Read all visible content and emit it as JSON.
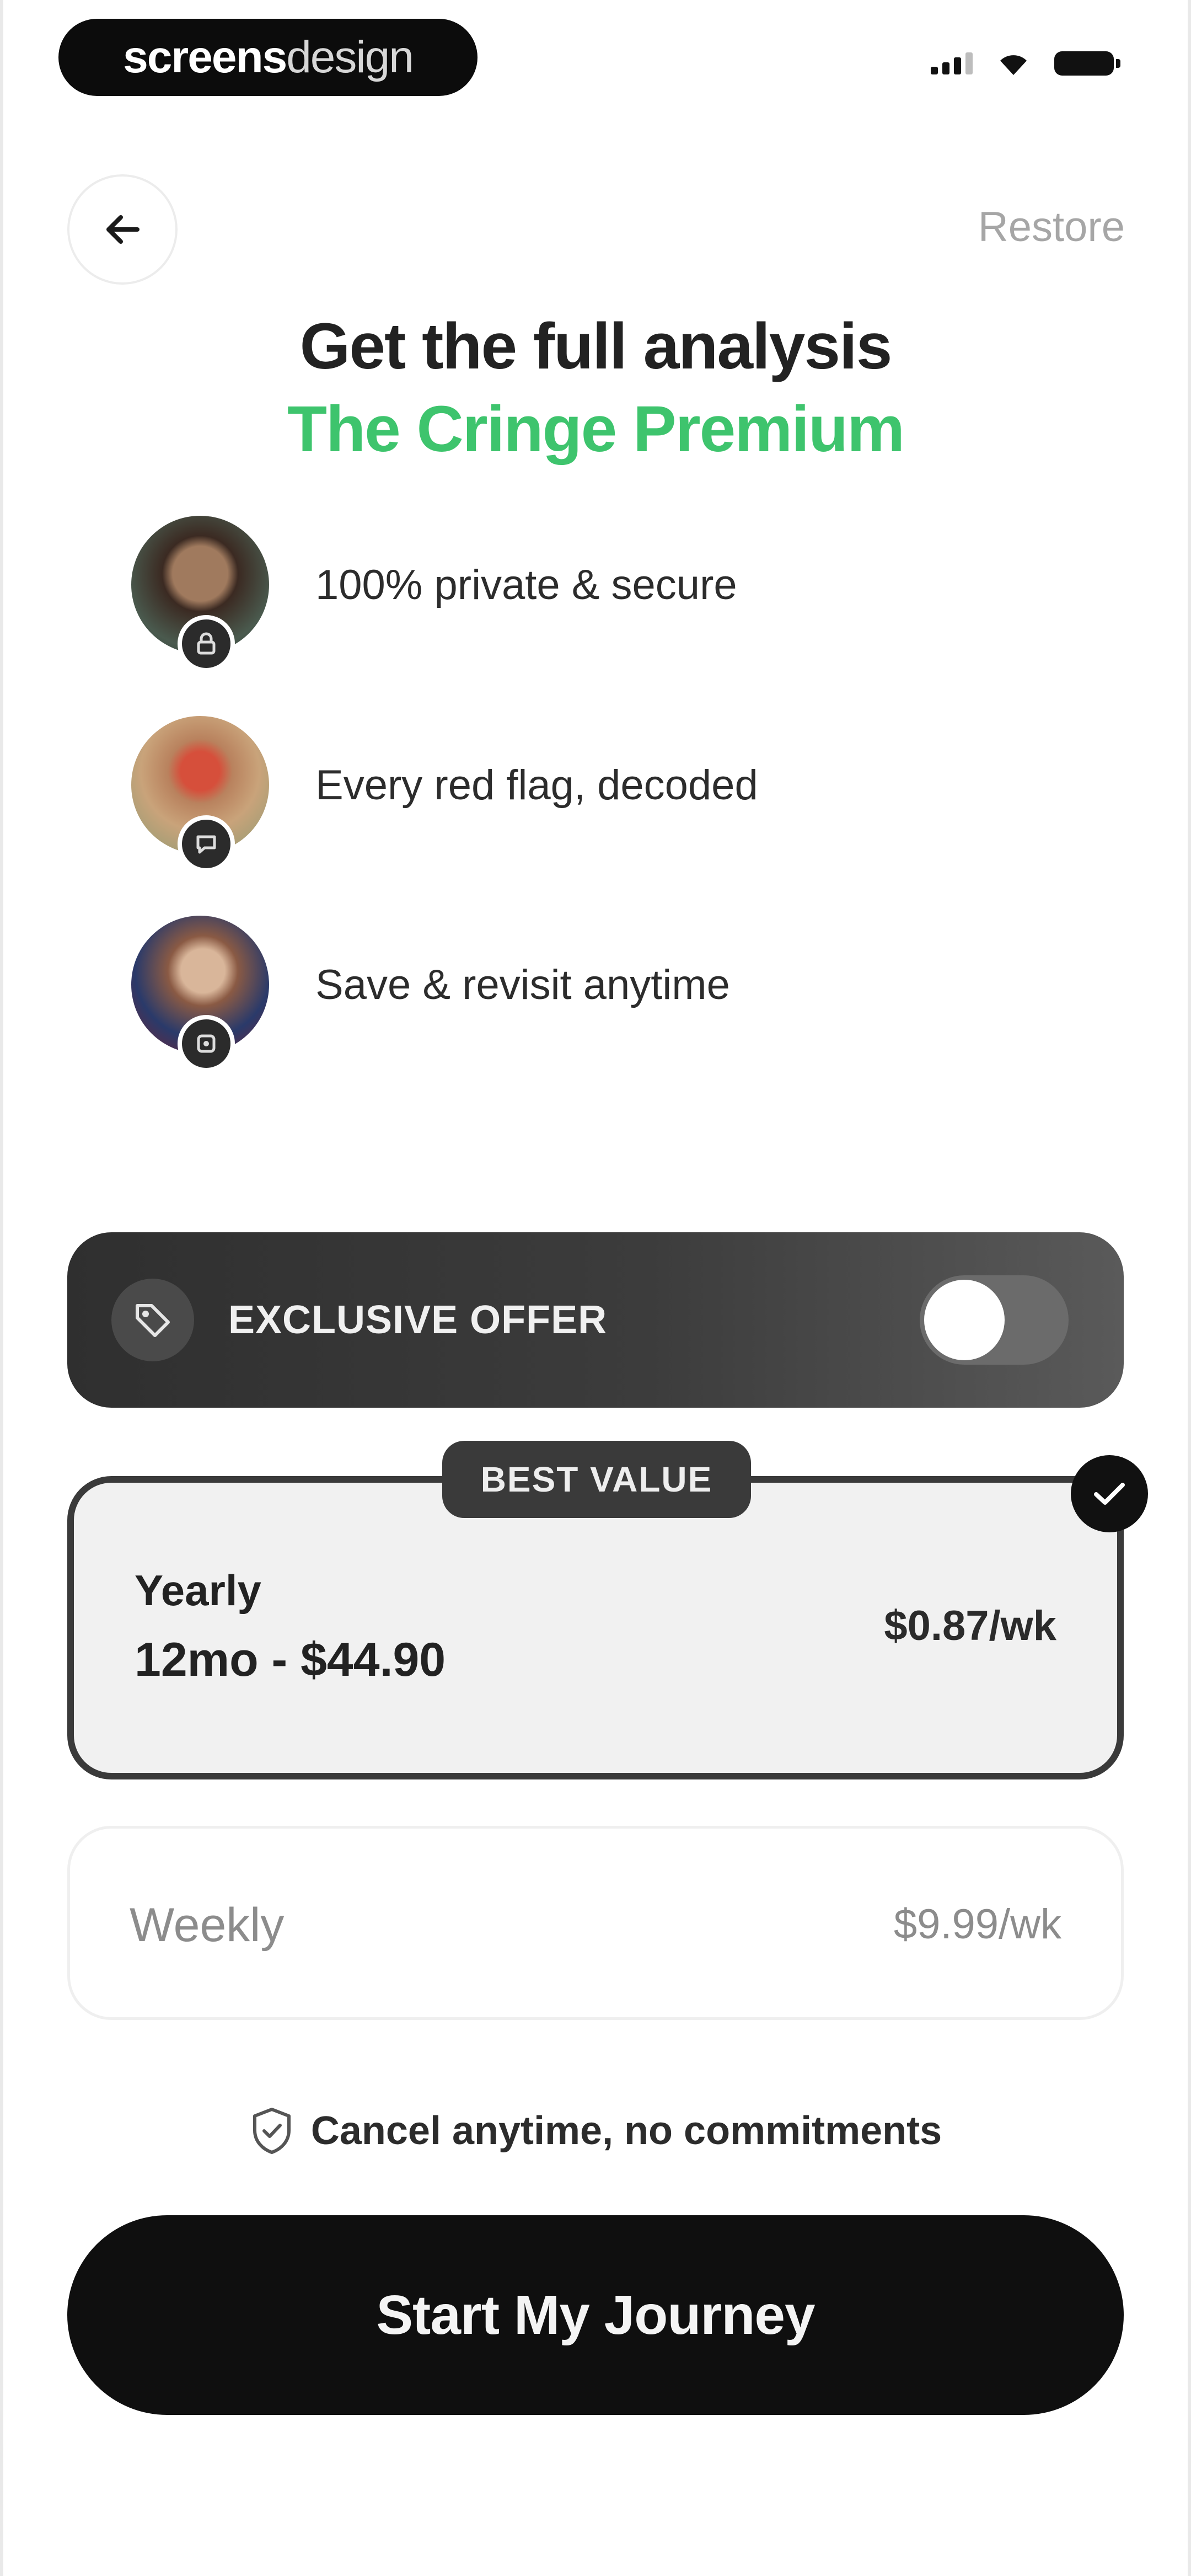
{
  "status_bar": {
    "brand_bold": "screens",
    "brand_light": "design",
    "icons": [
      "signal-icon",
      "wifi-icon",
      "battery-icon"
    ]
  },
  "nav": {
    "back_icon": "arrow-left-icon",
    "restore_label": "Restore"
  },
  "header": {
    "title": "Get the full analysis",
    "subtitle": "The Cringe Premium",
    "subtitle_color": "#3ec46d"
  },
  "features": [
    {
      "label": "100% private & secure",
      "badge_icon": "lock-icon"
    },
    {
      "label": "Every red flag, decoded",
      "badge_icon": "chat-icon"
    },
    {
      "label": "Save & revisit anytime",
      "badge_icon": "bookmark-icon"
    }
  ],
  "offer": {
    "icon": "tag-icon",
    "label": "EXCLUSIVE OFFER",
    "toggle_on": false
  },
  "plans": {
    "yearly": {
      "badge": "BEST VALUE",
      "name": "Yearly",
      "price": "12mo - $44.90",
      "weekly_price": "$0.87/wk",
      "selected": true
    },
    "weekly": {
      "name": "Weekly",
      "price": "$9.99/wk",
      "selected": false
    }
  },
  "footer": {
    "cancel_note": "Cancel anytime, no commitments",
    "cta_label": "Start My Journey"
  }
}
